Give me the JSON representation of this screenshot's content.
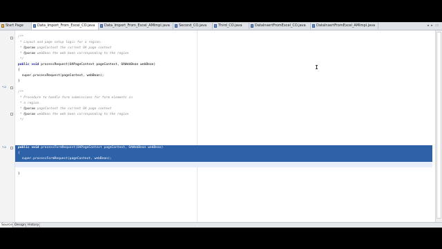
{
  "tabs": [
    {
      "label": "Start Page",
      "icon": "start-page-icon",
      "active": false
    },
    {
      "label": "Data_Import_From_Excel_CO.java",
      "icon": "java-file-icon",
      "active": true
    },
    {
      "label": "Data_Import_From_Excel_AMImpl.java",
      "icon": "java-file-icon",
      "active": false
    },
    {
      "label": "Second_CO.java",
      "icon": "java-file-icon",
      "active": false
    },
    {
      "label": "Third_CO.java",
      "icon": "java-file-icon",
      "active": false
    },
    {
      "label": "DataInsertFromExcel_CO.java",
      "icon": "java-file-icon",
      "active": false
    },
    {
      "label": "DataInsertFromExcel_AMImpl.java",
      "icon": "java-file-icon",
      "active": false
    }
  ],
  "code": {
    "l1": "/**",
    "l2": " * Layout and page setup logic for a region.",
    "l3a": " * ",
    "l3tag": "@param",
    "l3b": " pageContext the current OA page context",
    "l4a": " * ",
    "l4tag": "@param",
    "l4b": " webBean the web bean corresponding to the region",
    "l5": " */",
    "l6kw": "public void",
    "l6": " processRequest(OAPageContext pageContext, OAWebBean webBean)",
    "l7": "{",
    "l8": "  super.processRequest(pageContext, webBean);",
    "l9": "}",
    "l10": "/**",
    "l11": " * Procedure to handle form submissions for form elements in",
    "l12": " * a region.",
    "l13a": " * ",
    "l13tag": "@param",
    "l13b": " pageContext the current OA page context",
    "l14a": " * ",
    "l14tag": "@param",
    "l14b": " webBean the web bean corresponding to the region",
    "l15": " */",
    "l16kw": "public void",
    "l16": " processFormRequest(OAPageContext pageContext, OAWebBean webBean)",
    "l17": "{",
    "l18": "  super.processFormRequest(pageContext, webBean);",
    "l19": "",
    "l20": "}"
  },
  "bottom_tabs": [
    "Source",
    "Design",
    "History"
  ]
}
